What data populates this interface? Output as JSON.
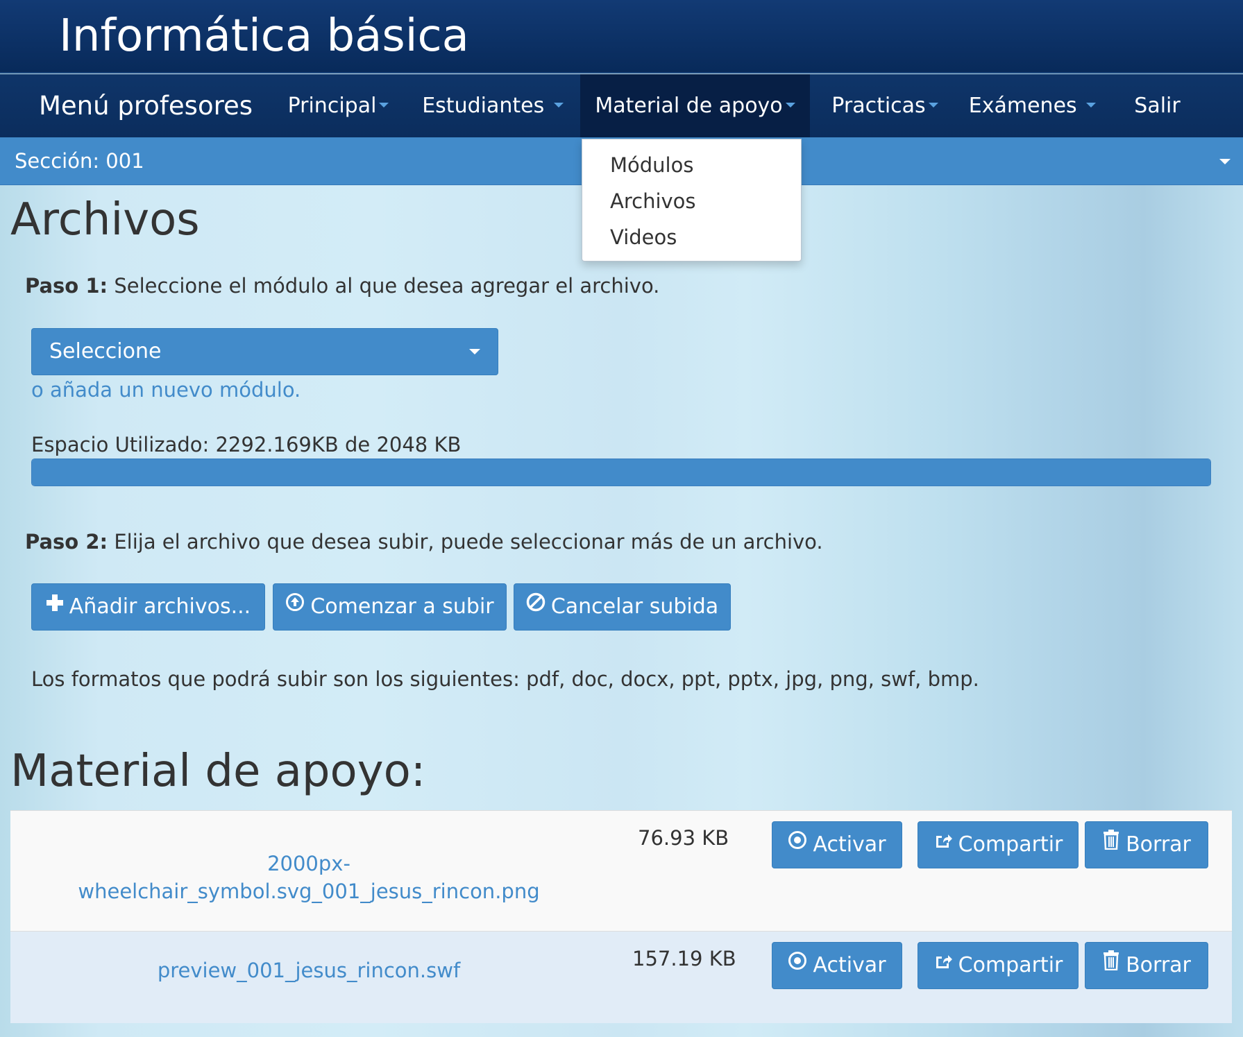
{
  "header": {
    "title": "Informática básica"
  },
  "nav": {
    "brand": "Menú profesores",
    "items": [
      {
        "label": "Principal"
      },
      {
        "label": "Estudiantes"
      },
      {
        "label": "Material de apoyo"
      },
      {
        "label": "Practicas"
      },
      {
        "label": "Exámenes"
      },
      {
        "label": "Salir"
      }
    ],
    "dropdown": [
      "Módulos",
      "Archivos",
      "Videos"
    ]
  },
  "subbar": {
    "label": "Sección: 001"
  },
  "page": {
    "title": "Archivos",
    "step1": {
      "prefix": "Paso 1:",
      "text": " Seleccione el módulo al que desea agregar el archivo."
    },
    "select": {
      "value": "Seleccione"
    },
    "new_module_link": "o añada un nuevo módulo.",
    "space": {
      "label": "Espacio Utilizado: 2292.169KB de 2048 KB",
      "used_fraction": 1.0
    },
    "step2": {
      "prefix": "Paso 2:",
      "text": " Elija el archivo que desea subir, puede seleccionar más de un archivo."
    },
    "buttons": {
      "add": "Añadir archivos...",
      "start": "Comenzar a subir",
      "cancel": "Cancelar subida"
    },
    "formats": "Los formatos que podrá subir son los siguientes: pdf, doc, docx, ppt, pptx, jpg, png, swf, bmp."
  },
  "material": {
    "title": "Material de apoyo:",
    "files": [
      {
        "name_line1": "2000px-",
        "name_line2": "wheelchair_symbol.svg_001_jesus_rincon.png",
        "size": "76.93 KB",
        "activate": "Activar",
        "share": "Compartir",
        "delete": "Borrar"
      },
      {
        "name": "preview_001_jesus_rincon.swf",
        "size": "157.19 KB",
        "activate": "Activar",
        "share": "Compartir",
        "delete": "Borrar"
      }
    ]
  },
  "colors": {
    "primary": "#428bca",
    "header_dark": "#082a5a",
    "nav_active": "#071f45"
  },
  "icons": [
    "plus-icon",
    "upload-circle-icon",
    "ban-icon",
    "record-circle-icon",
    "share-icon",
    "trash-icon",
    "caret-down-icon"
  ]
}
